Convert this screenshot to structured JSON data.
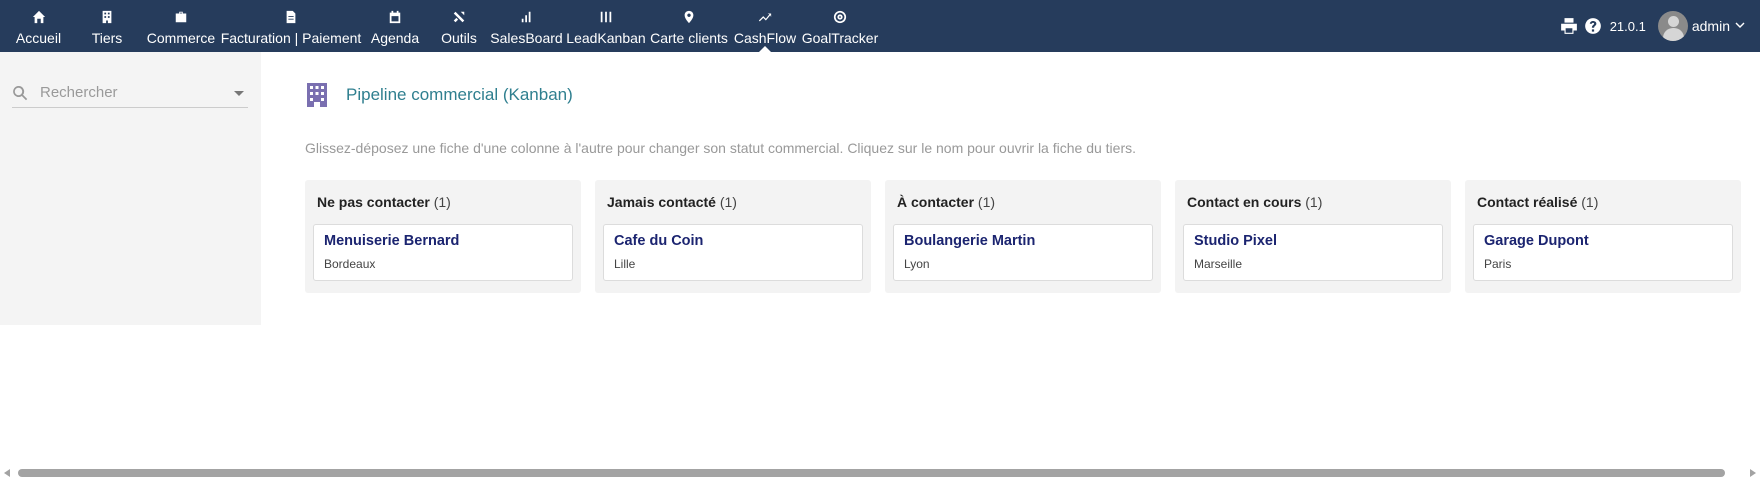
{
  "nav": {
    "items": [
      {
        "label": "Accueil",
        "icon": "home-icon"
      },
      {
        "label": "Tiers",
        "icon": "building-icon"
      },
      {
        "label": "Commerce",
        "icon": "briefcase-icon"
      },
      {
        "label": "Facturation | Paiement",
        "icon": "invoice-icon"
      },
      {
        "label": "Agenda",
        "icon": "calendar-icon"
      },
      {
        "label": "Outils",
        "icon": "tools-icon"
      },
      {
        "label": "SalesBoard",
        "icon": "bar-chart-icon"
      },
      {
        "label": "LeadKanban",
        "icon": "kanban-icon"
      },
      {
        "label": "Carte clients",
        "icon": "map-pin-icon"
      },
      {
        "label": "CashFlow",
        "icon": "trend-icon"
      },
      {
        "label": "GoalTracker",
        "icon": "target-icon"
      }
    ],
    "active": "CashFlow"
  },
  "topright": {
    "version": "21.0.1",
    "user": "admin"
  },
  "sidebar": {
    "search_placeholder": "Rechercher"
  },
  "page": {
    "title": "Pipeline commercial (Kanban)",
    "description": "Glissez-déposez une fiche d'une colonne à l'autre pour changer son statut commercial. Cliquez sur le nom pour ouvrir la fiche du tiers."
  },
  "columns": [
    {
      "name": "Ne pas contacter",
      "count": "(1)",
      "card": {
        "title": "Menuiserie Bernard",
        "city": "Bordeaux"
      }
    },
    {
      "name": "Jamais contacté",
      "count": "(1)",
      "card": {
        "title": "Cafe du Coin",
        "city": "Lille"
      }
    },
    {
      "name": "À contacter",
      "count": "(1)",
      "card": {
        "title": "Boulangerie Martin",
        "city": "Lyon"
      }
    },
    {
      "name": "Contact en cours",
      "count": "(1)",
      "card": {
        "title": "Studio Pixel",
        "city": "Marseille"
      }
    },
    {
      "name": "Contact réalisé",
      "count": "(1)",
      "card": {
        "title": "Garage Dupont",
        "city": "Paris"
      }
    }
  ],
  "colors": {
    "topbar": "#263c5c",
    "title": "#2f7f8f",
    "card_title": "#1b2470"
  }
}
